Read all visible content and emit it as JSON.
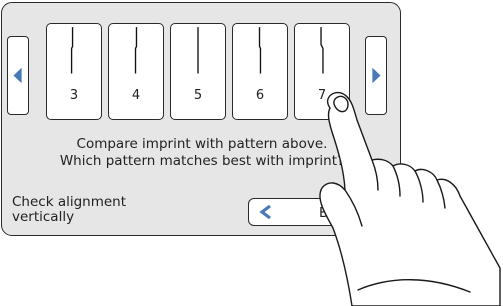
{
  "navigation": {
    "prev_icon": "left-triangle-icon",
    "next_icon": "right-triangle-icon",
    "accent_color": "#4a79b8"
  },
  "patterns": [
    {
      "label": "3"
    },
    {
      "label": "4"
    },
    {
      "label": "5"
    },
    {
      "label": "6"
    },
    {
      "label": "7"
    }
  ],
  "instructions": {
    "line1": "Compare imprint with pattern above.",
    "line2": "Which pattern matches best with imprint?"
  },
  "hint": {
    "line1": "Check alignment",
    "line2": "vertically"
  },
  "back_button": {
    "label": "Back",
    "icon": "back-chevron-icon"
  }
}
